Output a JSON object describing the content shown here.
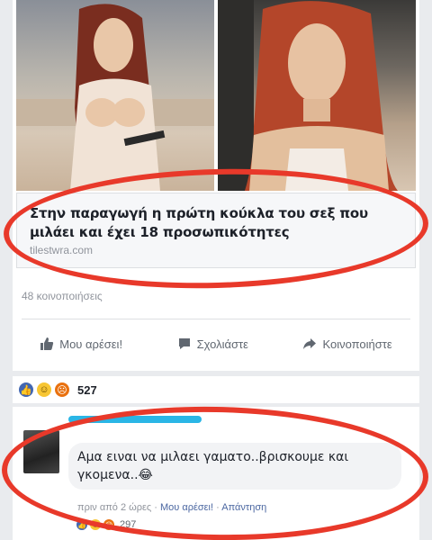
{
  "post": {
    "link_title": "Στην παραγωγή η πρώτη κούκλα του σεξ που μιλάει και έχει 18 προσωπικότητες",
    "link_domain": "tilestwra.com",
    "share_count": "48 κοινοποιήσεις",
    "actions": {
      "like": "Μου αρέσει!",
      "comment": "Σχολιάστε",
      "share": "Κοινοποιήστε"
    },
    "reactions": {
      "icons": [
        "like-icon",
        "haha-icon",
        "angry-icon"
      ],
      "count": "527"
    }
  },
  "comment": {
    "text": "Αμα ειναι να μιλαει γαματο..βρισκουμε και γκομενα..😂",
    "meta_time": "πριν από 2 ώρες",
    "meta_like": "Μου αρέσει!",
    "meta_reply": "Απάντηση",
    "reactions_count": "297"
  },
  "colors": {
    "facebook_blue": "#4267b2",
    "annotation_red": "#e8392a",
    "name_highlight": "#2ab6e6"
  }
}
